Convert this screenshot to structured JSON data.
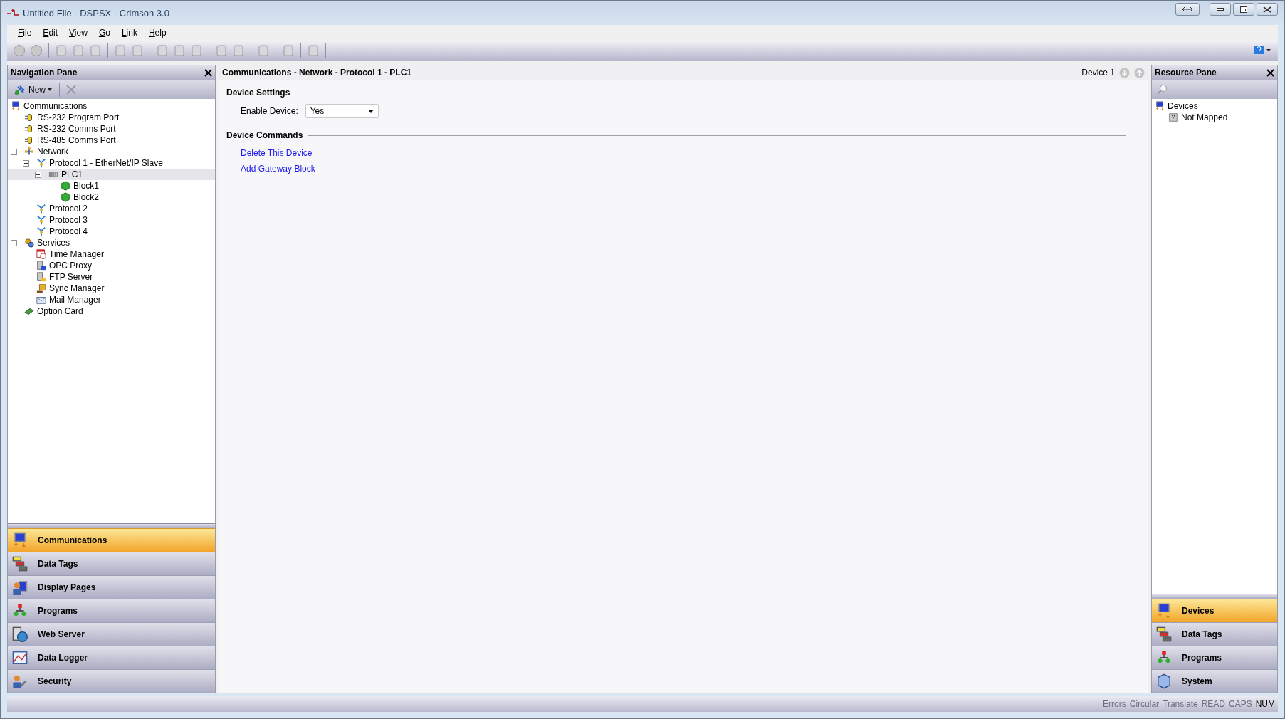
{
  "window": {
    "title": "Untitled File - DSPSX - Crimson 3.0"
  },
  "menu": [
    {
      "label": "File"
    },
    {
      "label": "Edit"
    },
    {
      "label": "View"
    },
    {
      "label": "Go"
    },
    {
      "label": "Link"
    },
    {
      "label": "Help"
    }
  ],
  "navigation_pane": {
    "title": "Navigation Pane",
    "new_button": "New",
    "tree": [
      {
        "label": "Communications",
        "kind": "comms",
        "selected": false,
        "children": [
          {
            "label": "RS-232 Program Port",
            "kind": "port",
            "selected": false
          },
          {
            "label": "RS-232 Comms Port",
            "kind": "port",
            "selected": false
          },
          {
            "label": "RS-485 Comms Port",
            "kind": "port",
            "selected": false
          },
          {
            "label": "Network",
            "kind": "network",
            "expanded": true,
            "selected": false,
            "children": [
              {
                "label": "Protocol 1 - EtherNet/IP Slave",
                "kind": "protocol",
                "expanded": true,
                "selected": false,
                "children": [
                  {
                    "label": "PLC1",
                    "kind": "device",
                    "expanded": true,
                    "selected": true,
                    "children": [
                      {
                        "label": "Block1",
                        "kind": "block",
                        "selected": false
                      },
                      {
                        "label": "Block2",
                        "kind": "block",
                        "selected": false
                      }
                    ]
                  }
                ]
              },
              {
                "label": "Protocol 2",
                "kind": "protocol",
                "selected": false
              },
              {
                "label": "Protocol 3",
                "kind": "protocol",
                "selected": false
              },
              {
                "label": "Protocol 4",
                "kind": "protocol",
                "selected": false
              }
            ]
          },
          {
            "label": "Services",
            "kind": "services",
            "expanded": true,
            "selected": false,
            "children": [
              {
                "label": "Time Manager",
                "kind": "clock",
                "selected": false
              },
              {
                "label": "OPC Proxy",
                "kind": "server",
                "selected": false
              },
              {
                "label": "FTP Server",
                "kind": "folder",
                "selected": false
              },
              {
                "label": "Sync Manager",
                "kind": "sync",
                "selected": false
              },
              {
                "label": "Mail Manager",
                "kind": "mail",
                "selected": false
              }
            ]
          },
          {
            "label": "Option Card",
            "kind": "card",
            "selected": false
          }
        ]
      }
    ],
    "sections": [
      {
        "label": "Communications",
        "kind": "comms",
        "selected": true
      },
      {
        "label": "Data Tags",
        "kind": "tags",
        "selected": false
      },
      {
        "label": "Display Pages",
        "kind": "display",
        "selected": false
      },
      {
        "label": "Programs",
        "kind": "programs",
        "selected": false
      },
      {
        "label": "Web Server",
        "kind": "web",
        "selected": false
      },
      {
        "label": "Data Logger",
        "kind": "logger",
        "selected": false
      },
      {
        "label": "Security",
        "kind": "security",
        "selected": false
      }
    ]
  },
  "editor": {
    "breadcrumb": "Communications - Network - Protocol 1 - PLC1",
    "device_label": "Device 1",
    "groups": [
      {
        "title": "Device Settings",
        "kind": "fields",
        "fields": [
          {
            "label": "Enable Device:",
            "value": "Yes"
          }
        ]
      },
      {
        "title": "Device Commands",
        "kind": "links",
        "links": [
          "Delete This Device",
          "Add Gateway Block"
        ]
      }
    ]
  },
  "resource_pane": {
    "title": "Resource Pane",
    "tree": [
      {
        "label": "Devices",
        "kind": "comms",
        "selected": false,
        "children": [
          {
            "label": "Not Mapped",
            "kind": "unknown",
            "selected": false
          }
        ]
      }
    ],
    "sections": [
      {
        "label": "Devices",
        "kind": "comms",
        "selected": true
      },
      {
        "label": "Data Tags",
        "kind": "tags",
        "selected": false
      },
      {
        "label": "Programs",
        "kind": "programs",
        "selected": false
      },
      {
        "label": "System",
        "kind": "system",
        "selected": false
      }
    ]
  },
  "status_bar": [
    {
      "label": "Errors",
      "on": false
    },
    {
      "label": "Circular",
      "on": false
    },
    {
      "label": "Translate",
      "on": false
    },
    {
      "label": "READ",
      "on": false
    },
    {
      "label": "CAPS",
      "on": false
    },
    {
      "label": "NUM",
      "on": true
    }
  ]
}
